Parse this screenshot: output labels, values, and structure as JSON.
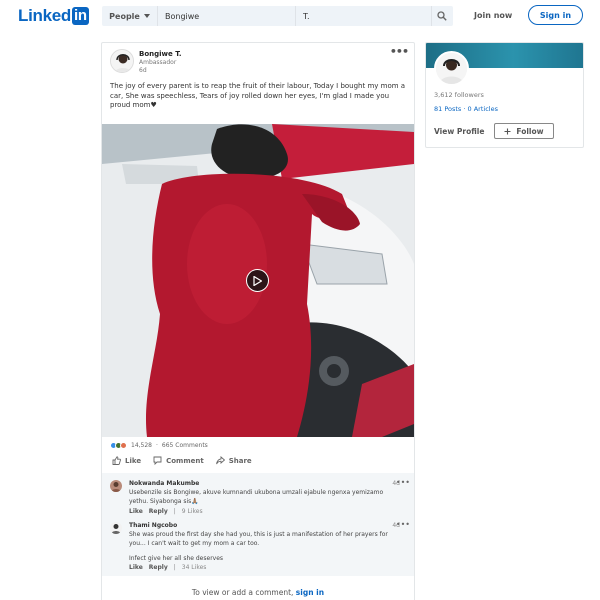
{
  "header": {
    "logo_text": "Linked",
    "logo_in": "in",
    "people_label": "People",
    "search_first_value": "Bongiwe",
    "search_last_value": "T.",
    "join_label": "Join now",
    "signin_label": "Sign in"
  },
  "post": {
    "author_name": "Bongiwe T.",
    "author_title": "Ambassador",
    "age": "6d",
    "more": "•••",
    "text": "The joy of every parent is to reap the fruit of their labour, Today I bought my mom a car, She was speechless, Tears of joy rolled down her eyes, I'm glad I made you proud mom♥",
    "reactions_count": "14,528",
    "comments_count": "665 Comments",
    "reaction_colors": [
      "#378fe9",
      "#44712e",
      "#df704d"
    ],
    "actions": {
      "like": "Like",
      "comment": "Comment",
      "share": "Share"
    }
  },
  "comments": [
    {
      "name": "Nokwanda Makumbe",
      "time": "4d",
      "more": "•••",
      "text": "Usebenzile sis Bongiwe, akuve kumnandi ukubona umzali ejabule ngenxa yemizamo yethu. Siyabonga sis🙏🏽",
      "like": "Like",
      "reply": "Reply",
      "likes": "9 Likes"
    },
    {
      "name": "Thami Ngcobo",
      "time": "4d",
      "more": "•••",
      "text": "She was proud the first day she had you, this is just a manifestation of her prayers for you... I can't wait to get my mom a car too.",
      "text2": "Infect give her all she deserves",
      "like": "Like",
      "reply": "Reply",
      "likes": "34 Likes"
    }
  ],
  "signin_note": {
    "prefix": "To view or add a comment, ",
    "link": "sign in"
  },
  "profile": {
    "followers": "3,612 followers",
    "posts": "81 Posts",
    "dot": " · ",
    "articles": "0 Articles",
    "view_profile": "View Profile",
    "follow": "Follow"
  }
}
